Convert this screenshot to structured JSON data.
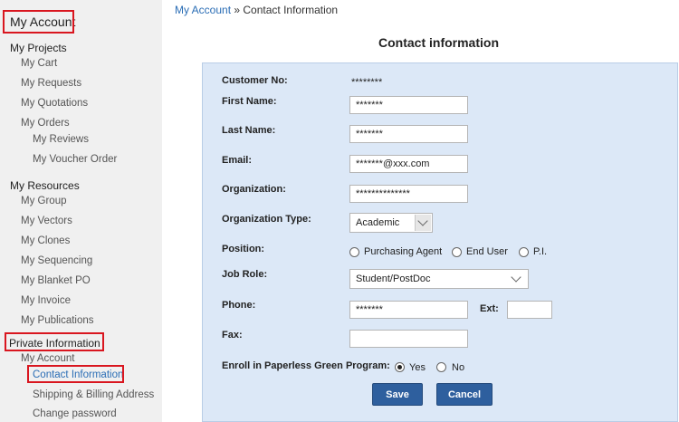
{
  "sidebar": {
    "title": "My Account",
    "projects_heading": "My Projects",
    "projects": [
      "My Cart",
      "My Requests",
      "My Quotations",
      "My Orders"
    ],
    "orders_sub": [
      "My Reviews",
      "My Voucher Order"
    ],
    "resources_heading": "My Resources",
    "resources": [
      "My Group",
      "My Vectors",
      "My Clones",
      "My Sequencing",
      "My Blanket PO",
      "My Invoice",
      "My Publications"
    ],
    "private_heading": "Private Information",
    "private_account": "My Account",
    "private_items": [
      "Contact Information",
      "Shipping & Billing Address",
      "Change password"
    ]
  },
  "breadcrumb": {
    "root": "My Account",
    "separator": " » ",
    "current": "Contact Information"
  },
  "page_title": "Contact information",
  "form": {
    "customer_no_label": "Customer No:",
    "customer_no_value": "********",
    "first_name_label": "First Name:",
    "first_name_value": "*******",
    "last_name_label": "Last Name:",
    "last_name_value": "*******",
    "email_label": "Email:",
    "email_value": "*******@xxx.com",
    "organization_label": "Organization:",
    "organization_value": "**************",
    "org_type_label": "Organization Type:",
    "org_type_value": "Academic",
    "position_label": "Position:",
    "position_options": [
      "Purchasing Agent",
      "End User",
      "P.I."
    ],
    "job_role_label": "Job Role:",
    "job_role_value": "Student/PostDoc",
    "phone_label": "Phone:",
    "phone_value": "*******",
    "ext_label": "Ext:",
    "ext_value": "",
    "fax_label": "Fax:",
    "fax_value": "",
    "paperless_label": "Enroll in Paperless Green Program:",
    "paperless_yes": "Yes",
    "paperless_no": "No",
    "paperless_selected": "Yes",
    "save_label": "Save",
    "cancel_label": "Cancel"
  },
  "colors": {
    "highlight": "#d9161f",
    "link": "#2a6db5",
    "button": "#2e5f9e",
    "panel": "#dce8f7",
    "sidebar": "#f0f0f0"
  }
}
